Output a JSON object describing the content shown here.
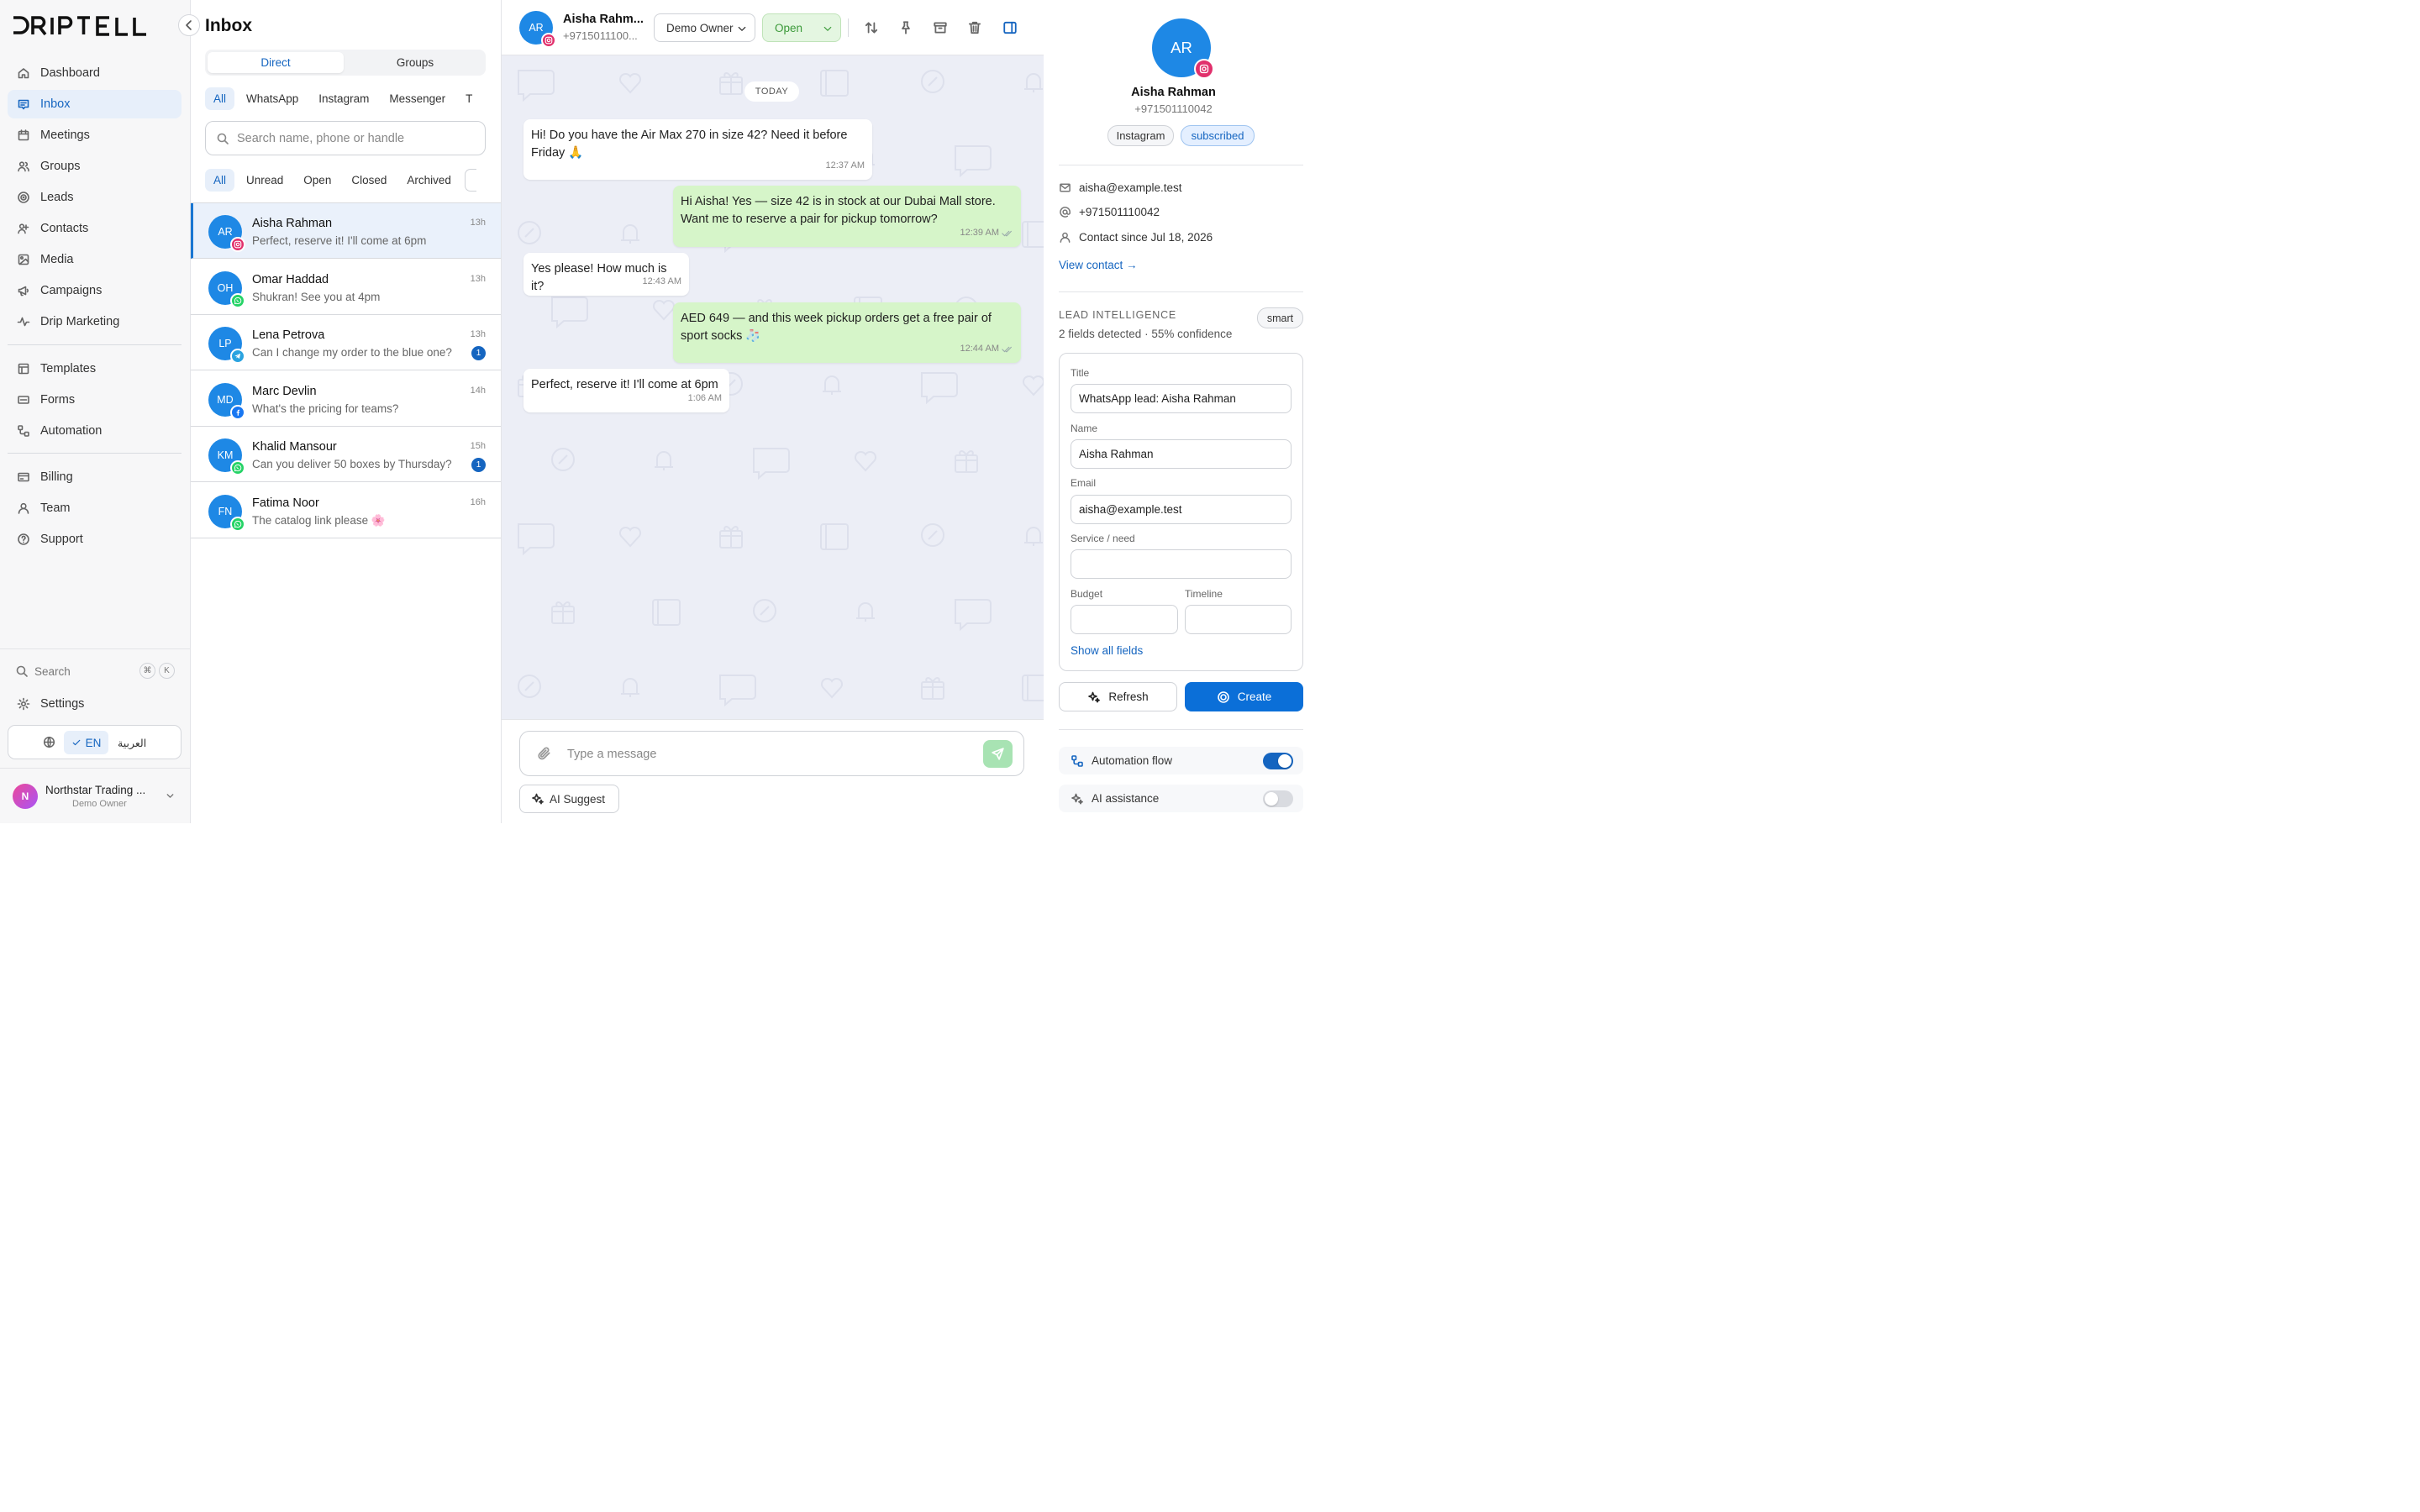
{
  "colors": {
    "accent": "#1565c0",
    "outgoing_bubble": "#d6f5c9",
    "status_open": "#3c9a3a",
    "whatsapp": "#25d366",
    "instagram": "#e1306c",
    "telegram": "#2aa3e0",
    "messenger": "#1877f2"
  },
  "brand": {
    "logo_text": "DRIPTELL"
  },
  "sidebar": {
    "nav_primary": [
      {
        "label": "Dashboard",
        "icon": "home-icon"
      },
      {
        "label": "Inbox",
        "icon": "inbox-icon",
        "active": true
      },
      {
        "label": "Meetings",
        "icon": "calendar-icon"
      },
      {
        "label": "Groups",
        "icon": "users-icon"
      },
      {
        "label": "Leads",
        "icon": "target-icon"
      },
      {
        "label": "Contacts",
        "icon": "contacts-icon"
      },
      {
        "label": "Media",
        "icon": "image-icon"
      },
      {
        "label": "Campaigns",
        "icon": "megaphone-icon"
      },
      {
        "label": "Drip Marketing",
        "icon": "activity-icon"
      }
    ],
    "nav_secondary": [
      {
        "label": "Templates",
        "icon": "template-icon"
      },
      {
        "label": "Forms",
        "icon": "form-icon"
      },
      {
        "label": "Automation",
        "icon": "workflow-icon"
      }
    ],
    "nav_tertiary": [
      {
        "label": "Billing",
        "icon": "card-icon"
      },
      {
        "label": "Team",
        "icon": "user-icon"
      },
      {
        "label": "Support",
        "icon": "help-icon"
      }
    ],
    "search_label": "Search",
    "search_shortcut": [
      "⌘",
      "K"
    ],
    "settings_label": "Settings",
    "lang_en": "EN",
    "lang_ar": "العربية",
    "profile": {
      "initial": "N",
      "name": "Northstar Trading ...",
      "role": "Demo Owner"
    }
  },
  "inbox": {
    "title": "Inbox",
    "tabs": [
      "Direct",
      "Groups"
    ],
    "channel_filters": [
      "All",
      "WhatsApp",
      "Instagram",
      "Messenger",
      "T"
    ],
    "search_placeholder": "Search name, phone or handle",
    "status_filters": [
      "All",
      "Unread",
      "Open",
      "Closed",
      "Archived"
    ],
    "conversations": [
      {
        "initials": "AR",
        "name": "Aisha Rahman",
        "preview": "Perfect, reserve it! I'll come at 6pm",
        "time": "13h",
        "channel": "instagram",
        "selected": true
      },
      {
        "initials": "OH",
        "name": "Omar Haddad",
        "preview": "Shukran! See you at 4pm",
        "time": "13h",
        "channel": "whatsapp"
      },
      {
        "initials": "LP",
        "name": "Lena Petrova",
        "preview": "Can I change my order to the blue one?",
        "time": "13h",
        "channel": "telegram",
        "unread": "1"
      },
      {
        "initials": "MD",
        "name": "Marc Devlin",
        "preview": "What's the pricing for teams?",
        "time": "14h",
        "channel": "messenger"
      },
      {
        "initials": "KM",
        "name": "Khalid Mansour",
        "preview": "Can you deliver 50 boxes by Thursday?",
        "time": "15h",
        "channel": "whatsapp",
        "unread": "1"
      },
      {
        "initials": "FN",
        "name": "Fatima Noor",
        "preview": "The catalog link please 🌸",
        "time": "16h",
        "channel": "whatsapp"
      }
    ]
  },
  "chat": {
    "contact_initials": "AR",
    "contact_name": "Aisha Rahm...",
    "contact_phone": "+9715011100...",
    "owner_select": "Demo Owner",
    "status_select": "Open",
    "day_label": "TODAY",
    "messages": [
      {
        "dir": "in",
        "text": "Hi! Do you have the Air Max 270 in size 42? Need it before Friday 🙏",
        "time": "12:37 AM"
      },
      {
        "dir": "out",
        "text": "Hi Aisha! Yes — size 42 is in stock at our Dubai Mall store. Want me to reserve a pair for pickup tomorrow?",
        "time": "12:39 AM"
      },
      {
        "dir": "in",
        "text": "Yes please! How much is it?",
        "time": "12:43 AM"
      },
      {
        "dir": "out",
        "text": "AED 649 — and this week pickup orders get a free pair of sport socks 🧦",
        "time": "12:44 AM"
      },
      {
        "dir": "in",
        "text": "Perfect, reserve it! I'll come at 6pm",
        "time": "1:06 AM"
      }
    ],
    "composer_placeholder": "Type a message",
    "ai_suggest_label": "AI Suggest"
  },
  "contact_panel": {
    "initials": "AR",
    "name": "Aisha Rahman",
    "phone": "+971501110042",
    "tags": [
      "Instagram",
      "subscribed"
    ],
    "email": "aisha@example.test",
    "handle": "+971501110042",
    "since": "Contact since Jul 18, 2026",
    "view_contact": "View contact →",
    "lead": {
      "heading": "LEAD INTELLIGENCE",
      "badge": "smart",
      "summary": "2 fields detected · 55% confidence",
      "labels": {
        "title": "Title",
        "name": "Name",
        "email": "Email",
        "service": "Service / need",
        "budget": "Budget",
        "timeline": "Timeline"
      },
      "values": {
        "title": "WhatsApp lead: Aisha Rahman",
        "name": "Aisha Rahman",
        "email": "aisha@example.test",
        "service": "",
        "budget": "",
        "timeline": ""
      },
      "show_all": "Show all fields"
    },
    "refresh_label": "Refresh",
    "create_label": "Create",
    "toggles": [
      {
        "label": "Automation flow",
        "on": true
      },
      {
        "label": "AI assistance",
        "on": false
      }
    ]
  }
}
